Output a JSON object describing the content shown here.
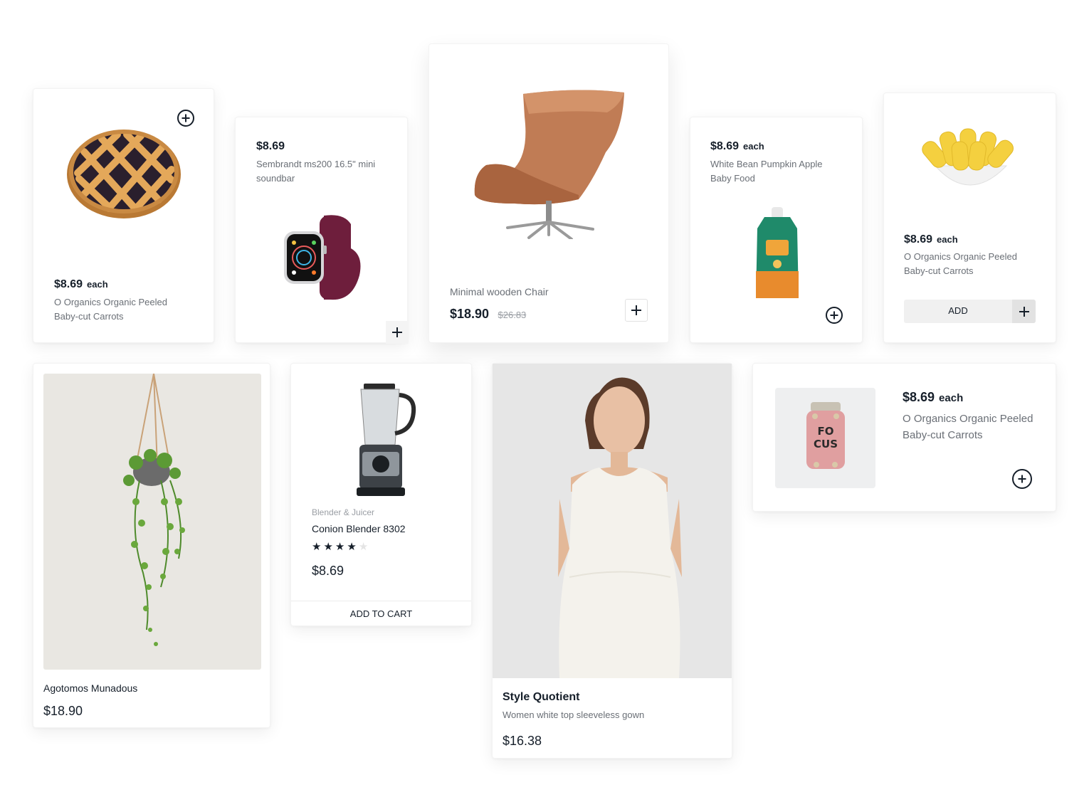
{
  "cards": {
    "pie": {
      "price": "$8.69",
      "unit": "each",
      "name": "O Organics Organic Peeled Baby-cut Carrots"
    },
    "watch": {
      "price": "$8.69",
      "name": "Sembrandt ms200 16.5\" mini soundbar"
    },
    "chair": {
      "name": "Minimal wooden Chair",
      "price": "$18.90",
      "old_price": "$26.83"
    },
    "babyfood": {
      "price": "$8.69",
      "unit": "each",
      "name": "White Bean Pumpkin Apple Baby Food"
    },
    "corn": {
      "price": "$8.69",
      "unit": "each",
      "name": "O Organics Organic Peeled Baby-cut Carrots",
      "add_label": "ADD"
    },
    "plant": {
      "name": "Agotomos Munadous",
      "price": "$18.90"
    },
    "blender": {
      "category": "Blender & Juicer",
      "name": "Conion Blender 8302",
      "rating": 4,
      "rating_max": 5,
      "price": "$8.69",
      "cta": "ADD TO CART"
    },
    "fashion": {
      "brand": "Style Quotient",
      "name": "Women white top sleeveless gown",
      "price": "$16.38"
    },
    "vitamin": {
      "price": "$8.69",
      "unit": "each",
      "name": "O Organics Organic Peeled Baby-cut Carrots",
      "jar_text_1": "FO",
      "jar_text_2": "CUS"
    }
  },
  "icons": {
    "add": "plus-icon",
    "add_circle": "plus-circle-icon",
    "star": "star-icon"
  }
}
